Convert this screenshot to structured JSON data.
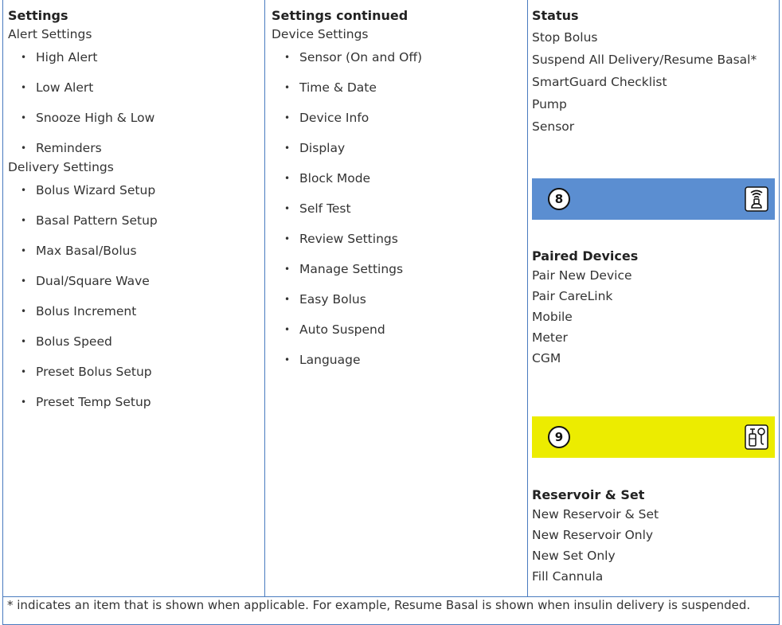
{
  "col1": {
    "title": "Settings",
    "alert": {
      "label": "Alert Settings",
      "items": [
        "High Alert",
        "Low Alert",
        "Snooze High & Low",
        "Reminders"
      ]
    },
    "delivery": {
      "label": "Delivery Settings",
      "items": [
        "Bolus Wizard Setup",
        "Basal Pattern Setup",
        "Max Basal/Bolus",
        "Dual/Square Wave",
        "Bolus Increment",
        "Bolus Speed",
        "Preset Bolus Setup",
        "Preset Temp Setup"
      ]
    }
  },
  "col2": {
    "title": "Settings continued",
    "device": {
      "label": "Device Settings",
      "items": [
        "Sensor (On and Off)",
        "Time & Date",
        "Device Info",
        "Display",
        "Block Mode",
        "Self Test",
        "Review Settings",
        "Manage Settings",
        "Easy Bolus",
        "Auto Suspend",
        "Language"
      ]
    }
  },
  "col3": {
    "status": {
      "title": "Status",
      "items": [
        "Stop Bolus",
        "Suspend All Delivery/Resume Basal*",
        "SmartGuard Checklist",
        "Pump",
        "Sensor"
      ]
    },
    "banner8": {
      "number": "8",
      "icon": "paired-devices-icon",
      "color": "#5b8ed1"
    },
    "paired": {
      "title": "Paired Devices",
      "items": [
        "Pair New Device",
        "Pair CareLink",
        "Mobile",
        "Meter",
        "CGM"
      ]
    },
    "banner9": {
      "number": "9",
      "icon": "reservoir-set-icon",
      "color": "#ecec00"
    },
    "reservoir": {
      "title": "Reservoir & Set",
      "items": [
        "New Reservoir & Set",
        "New Reservoir Only",
        "New Set Only",
        "Fill Cannula"
      ]
    }
  },
  "footnote": "* indicates an item that is shown when applicable. For example, Resume Basal is shown when insulin delivery is suspended.",
  "colors": {
    "rule": "#4a7bbf",
    "text": "#333333"
  }
}
